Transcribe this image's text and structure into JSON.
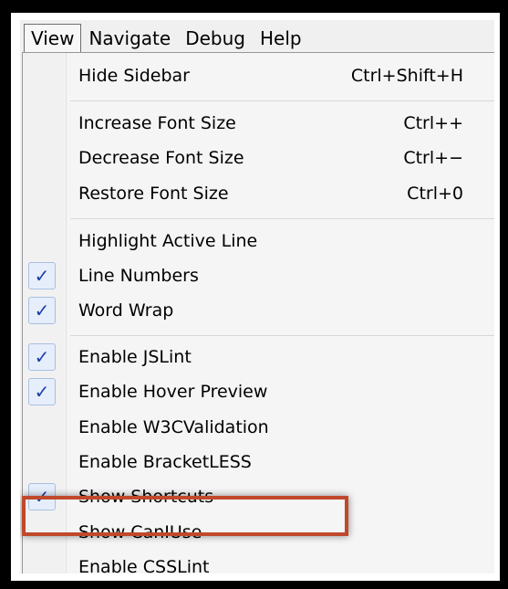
{
  "menubar": {
    "items": [
      "View",
      "Navigate",
      "Debug",
      "Help"
    ]
  },
  "menu": {
    "items": [
      {
        "label": "Hide Sidebar",
        "shortcut": "Ctrl+Shift+H",
        "checked": false
      },
      {
        "label": "Increase Font Size",
        "shortcut": "Ctrl++",
        "checked": false
      },
      {
        "label": "Decrease Font Size",
        "shortcut": "Ctrl+−",
        "checked": false
      },
      {
        "label": "Restore Font Size",
        "shortcut": "Ctrl+0",
        "checked": false
      },
      {
        "label": "Highlight Active Line",
        "shortcut": "",
        "checked": false
      },
      {
        "label": "Line Numbers",
        "shortcut": "",
        "checked": true
      },
      {
        "label": "Word Wrap",
        "shortcut": "",
        "checked": true
      },
      {
        "label": "Enable JSLint",
        "shortcut": "",
        "checked": true
      },
      {
        "label": "Enable Hover Preview",
        "shortcut": "",
        "checked": true
      },
      {
        "label": "Enable W3CValidation",
        "shortcut": "",
        "checked": false
      },
      {
        "label": "Enable BracketLESS",
        "shortcut": "",
        "checked": false
      },
      {
        "label": "Show Shortcuts",
        "shortcut": "",
        "checked": true
      },
      {
        "label": "Show CanIUse",
        "shortcut": "",
        "checked": false
      },
      {
        "label": "Enable CSSLint",
        "shortcut": "",
        "checked": false
      }
    ]
  },
  "checkmark_glyph": "✓",
  "colors": {
    "highlight_border": "#c0492c",
    "check": "#1c3fa8"
  }
}
